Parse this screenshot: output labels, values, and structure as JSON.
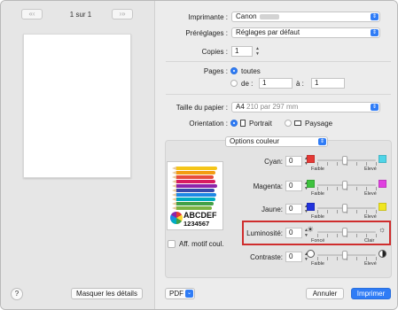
{
  "nav": {
    "first_prev": "«‹",
    "page": "1 sur 1",
    "next_last": "›»"
  },
  "left": {
    "help": "?",
    "hide_details": "Masquer les détails"
  },
  "printer": {
    "label": "Imprimante :",
    "value": "Canon"
  },
  "presets": {
    "label": "Préréglages :",
    "value": "Réglages par défaut"
  },
  "copies": {
    "label": "Copies :",
    "value": "1"
  },
  "pages": {
    "label": "Pages :",
    "all": "toutes",
    "from": "de :",
    "from_value": "1",
    "to": "à :",
    "to_value": "1"
  },
  "paper": {
    "label": "Taille du papier :",
    "value_main": "A4",
    "value_dim": "210 par 297 mm"
  },
  "orientation": {
    "label": "Orientation :",
    "portrait": "Portrait",
    "landscape": "Paysage"
  },
  "section": {
    "value": "Options couleur"
  },
  "thumbnail": {
    "line1": "ABCDEF",
    "line2": "1234567"
  },
  "pattern_checkbox": {
    "label": "Aff. motif coul."
  },
  "sliders": [
    {
      "label": "Cyan:",
      "value": "0",
      "left": "Faible",
      "right": "Elevé",
      "color": "#4fd5e8"
    },
    {
      "label": "Magenta:",
      "value": "0",
      "left": "Faible",
      "right": "Elevé",
      "color": "#e040e0"
    },
    {
      "label": "Jaune:",
      "value": "0",
      "left": "Faible",
      "right": "Elevé",
      "color": "#f0e620"
    },
    {
      "label": "Luminosité:",
      "value": "0",
      "left": "Foncé",
      "right": "Clair"
    },
    {
      "label": "Contraste:",
      "value": "0",
      "left": "Faible",
      "right": "Elevé"
    }
  ],
  "footer": {
    "pdf": "PDF",
    "cancel": "Annuler",
    "print": "Imprimer"
  },
  "colors": {
    "accent": "#2f7cf6",
    "highlight": "#cf2d2d",
    "red": "#e53935",
    "green": "#3ec23e",
    "blue": "#2233dd"
  }
}
